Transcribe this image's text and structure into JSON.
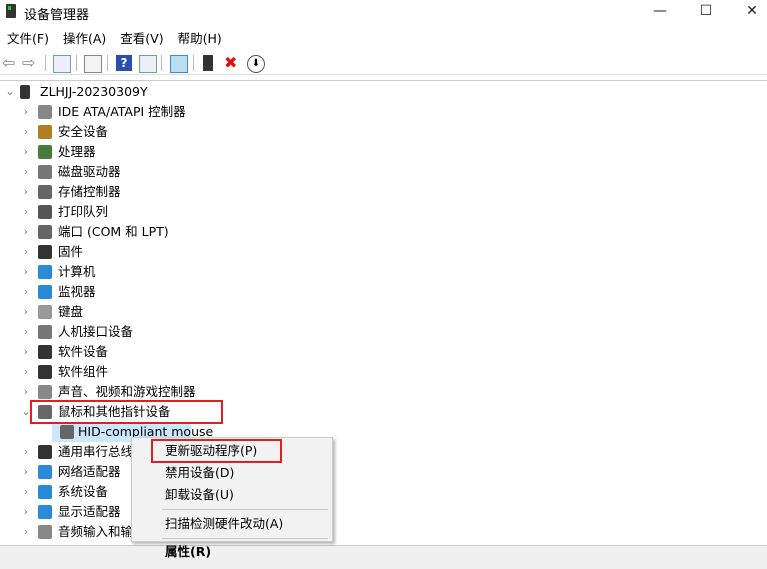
{
  "window": {
    "title": "设备管理器",
    "minimize": "—",
    "maximize": "☐",
    "close": "✕"
  },
  "menubar": [
    "文件(F)",
    "操作(A)",
    "查看(V)",
    "帮助(H)"
  ],
  "toolbar": [
    "back-icon",
    "forward-icon",
    "show-hide-console-tree-icon",
    "properties-icon",
    "help-icon",
    "action-pane-icon",
    "scan-hardware-icon",
    "update-driver-icon",
    "uninstall-icon",
    "disable-icon"
  ],
  "tree": {
    "root": "ZLHJJ-20230309Y",
    "items": [
      {
        "label": "IDE ATA/ATAPI 控制器",
        "color": "#888"
      },
      {
        "label": "安全设备",
        "color": "#b08020"
      },
      {
        "label": "处理器",
        "color": "#4a7a3a"
      },
      {
        "label": "磁盘驱动器",
        "color": "#777"
      },
      {
        "label": "存储控制器",
        "color": "#666"
      },
      {
        "label": "打印队列",
        "color": "#555"
      },
      {
        "label": "端口 (COM 和 LPT)",
        "color": "#666"
      },
      {
        "label": "固件",
        "color": "#333"
      },
      {
        "label": "计算机",
        "color": "#2a8ad8"
      },
      {
        "label": "监视器",
        "color": "#2a8ad8"
      },
      {
        "label": "键盘",
        "color": "#999"
      },
      {
        "label": "人机接口设备",
        "color": "#777"
      },
      {
        "label": "软件设备",
        "color": "#333"
      },
      {
        "label": "软件组件",
        "color": "#333"
      },
      {
        "label": "声音、视频和游戏控制器",
        "color": "#888"
      },
      {
        "label": "鼠标和其他指针设备",
        "color": "#666",
        "expanded": true
      },
      {
        "label": "HID-compliant mouse",
        "color": "#666",
        "child": true,
        "selected": true
      },
      {
        "label": "通用串行总线控制器",
        "color": "#333"
      },
      {
        "label": "网络适配器",
        "color": "#2a8ad8"
      },
      {
        "label": "系统设备",
        "color": "#2a8ad8"
      },
      {
        "label": "显示适配器",
        "color": "#2a8ad8"
      },
      {
        "label": "音频输入和输出",
        "color": "#888"
      }
    ]
  },
  "context_menu": {
    "update_driver": "更新驱动程序(P)",
    "disable": "禁用设备(D)",
    "uninstall": "卸载设备(U)",
    "scan": "扫描检测硬件改动(A)",
    "properties": "属性(R)"
  },
  "highlight_color": "#e02020"
}
